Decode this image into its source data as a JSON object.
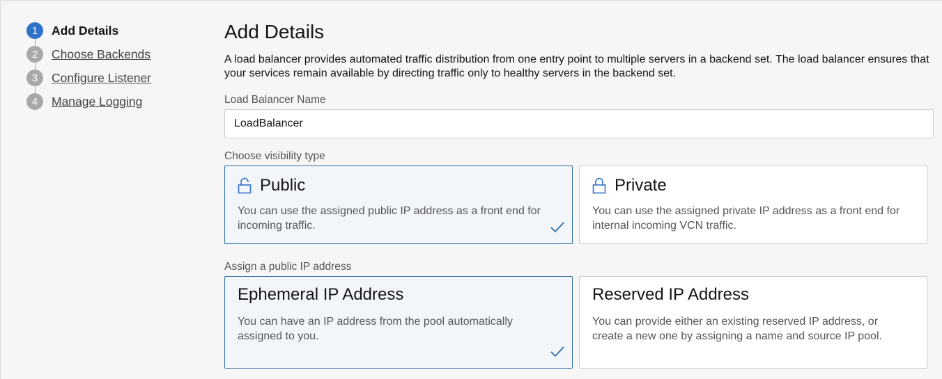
{
  "steps": [
    {
      "number": "1",
      "label": "Add Details",
      "active": true
    },
    {
      "number": "2",
      "label": "Choose Backends",
      "active": false
    },
    {
      "number": "3",
      "label": "Configure Listener",
      "active": false
    },
    {
      "number": "4",
      "label": "Manage Logging",
      "active": false
    }
  ],
  "main": {
    "title": "Add Details",
    "description": "A load balancer provides automated traffic distribution from one entry point to multiple servers in a backend set. The load balancer ensures that your services remain available by directing traffic only to healthy servers in the backend set.",
    "name_label": "Load Balancer Name",
    "name_value": "LoadBalancer",
    "visibility_label": "Choose visibility type",
    "ip_label": "Assign a public IP address"
  },
  "visibility_options": {
    "public": {
      "title": "Public",
      "description": "You can use the assigned public IP address as a front end for incoming traffic.",
      "selected": true,
      "icon": "unlocked-padlock-icon"
    },
    "private": {
      "title": "Private",
      "description": "You can use the assigned private IP address as a front end for internal incoming VCN traffic.",
      "selected": false,
      "icon": "padlock-icon"
    }
  },
  "ip_options": {
    "ephemeral": {
      "title": "Ephemeral IP Address",
      "description": "You can have an IP address from the pool automatically assigned to you.",
      "selected": true
    },
    "reserved": {
      "title": "Reserved IP Address",
      "description": "You can provide either an existing reserved IP address, or create a new one by assigning a name and source IP pool.",
      "selected": false
    }
  },
  "colors": {
    "accent": "#2f73c9",
    "selected_border": "#2f6ea8",
    "inactive_step": "#a8a8a8"
  }
}
